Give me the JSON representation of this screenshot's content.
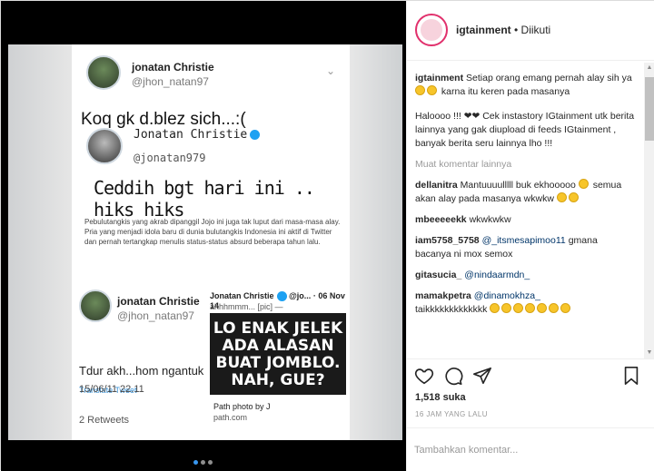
{
  "post": {
    "account": "igtainment",
    "follow_status": "• Diikuti",
    "likes": "1,518 suka",
    "time_ago": "16 JAM YANG LALU",
    "add_comment_placeholder": "Tambahkan komentar..."
  },
  "media": {
    "tweet1": {
      "name": "jonatan Christie",
      "handle": "@jhon_natan97",
      "text": "Koq gk d.blez sich...:("
    },
    "tweet2": {
      "name": "Jonatan Christie",
      "handle": "@jonatan979",
      "text": "Ceddih bgt hari ini .. hiks hiks"
    },
    "caption_para": "Pebulutangkis yang akrab dipanggil Jojo ini juga tak luput dari masa-masa alay. Pria yang menjadi idola baru di dunia bulutangkis Indonesia ini aktif di Twitter dan pernah tertangkap menulis status-status absurd beberapa tahun lalu.",
    "tweet3": {
      "name": "jonatan Christie",
      "handle": "@jhon_natan97",
      "text": "Tdur akh...hom ngantuk",
      "translate": "Translate Tweet",
      "date": "15/06/11 22.11",
      "retweets": "2 Retweets"
    },
    "quoted": {
      "header": "Jonatan Christie",
      "handle_short": "@jo...",
      "date": "06 Nov 14",
      "text": "ahhhmmm... [pic] —",
      "meme": "LO ENAK JELEK ADA ALASAN BUAT JOMBLO. NAH, GUE?",
      "path1": "Path photo by J",
      "path2": "path.com"
    },
    "chevron": "⌄"
  },
  "comments": {
    "caption": {
      "user": "igtainment",
      "text1": "Setiap orang emang pernah alay sih ya",
      "text2": "karna itu keren pada masanya"
    },
    "caption2": "Haloooo !!! ❤❤ Cek instastory IGtainment utk berita lainnya yang gak diupload di feeds IGtainment , banyak berita seru lainnya lho !!!",
    "load_more": "Muat komentar lainnya",
    "list": [
      {
        "user": "dellanitra",
        "text": "Mantuuuulllll buk ekhooooo",
        "text2": "semua akan alay pada masanya wkwkw"
      },
      {
        "user": "mbeeeeekk",
        "text": "wkwkwkw"
      },
      {
        "user": "iam5758_5758",
        "mention": "@_itsmesapimoo11",
        "text": "gmana bacanya ni mox semox"
      },
      {
        "user": "gitasucia_",
        "mention": "@nindaarmdn_"
      },
      {
        "user": "mamakpetra",
        "mention": "@dinamokhza_",
        "text": "taikkkkkkkkkkkkk"
      }
    ]
  }
}
